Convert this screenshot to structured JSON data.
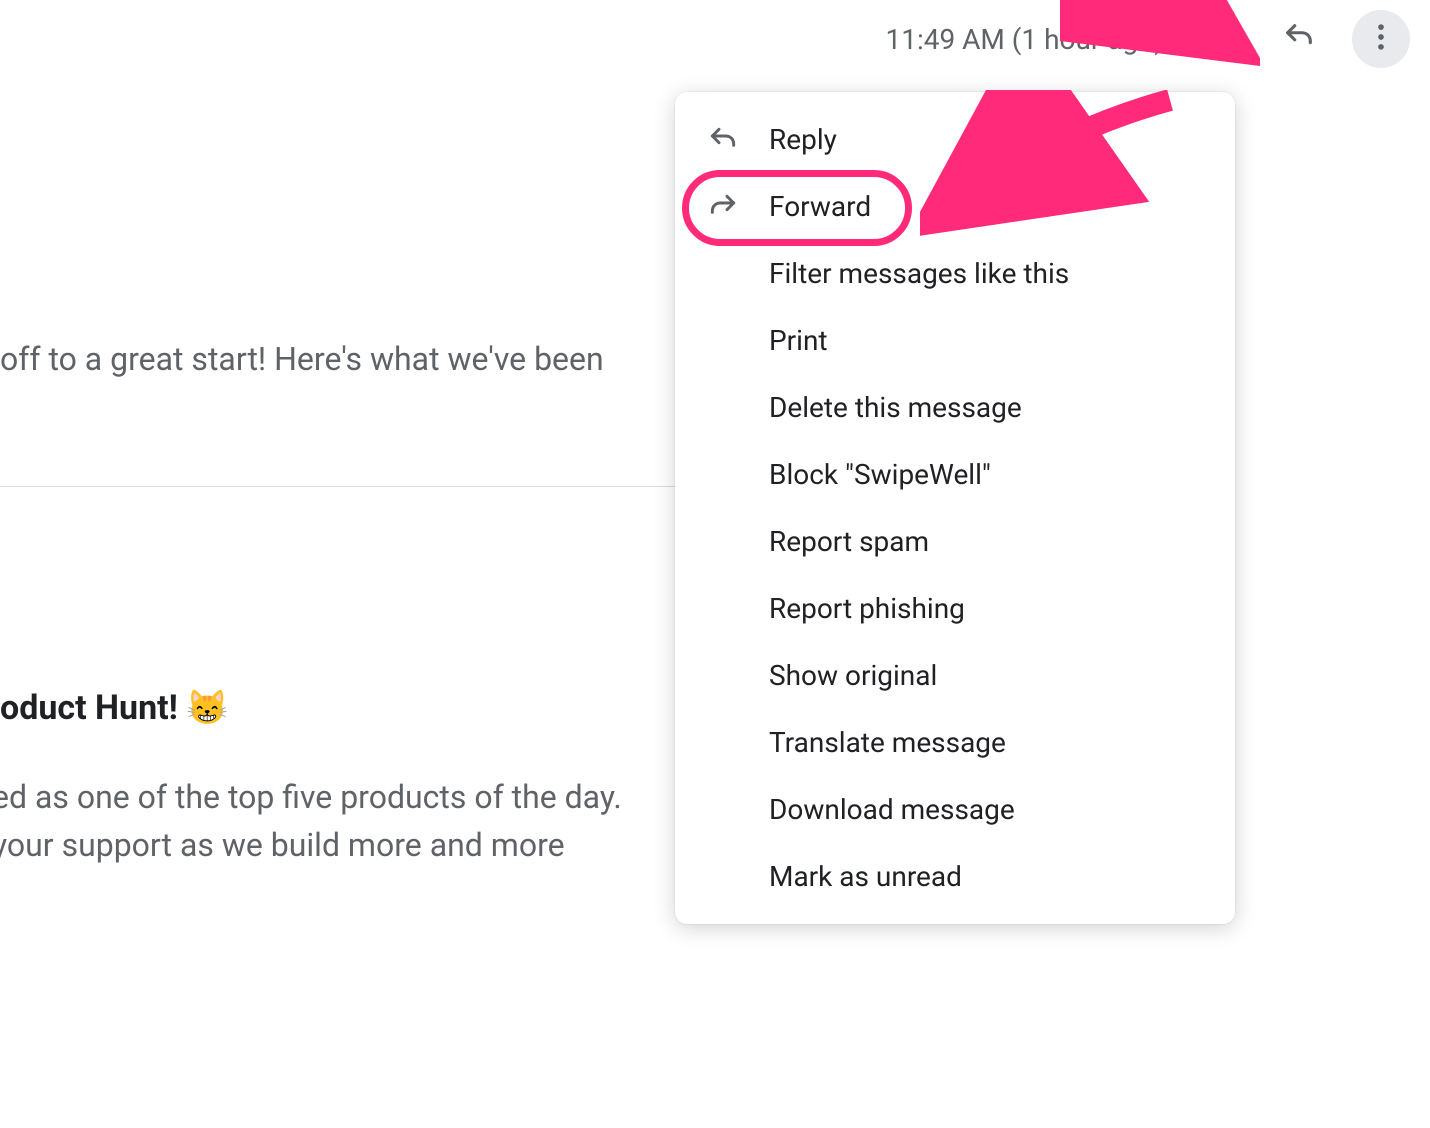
{
  "header": {
    "timestamp": "11:49 AM (1 hour ago)"
  },
  "menu": {
    "reply": "Reply",
    "forward": "Forward",
    "filter": "Filter messages like this",
    "print": "Print",
    "delete": "Delete this message",
    "block": "Block \"SwipeWell\"",
    "report_spam": "Report spam",
    "report_phishing": "Report phishing",
    "show_original": "Show original",
    "translate": "Translate message",
    "download": "Download message",
    "mark_unread": "Mark as unread"
  },
  "body": {
    "line1": "off to a great start! Here's what we've been",
    "heading": "oduct Hunt! 😸",
    "line3": "ed as one of the top five products of the day.",
    "line4": "your support as we build more and more"
  },
  "annotation": {
    "highlight_color": "#ff2a7a"
  }
}
